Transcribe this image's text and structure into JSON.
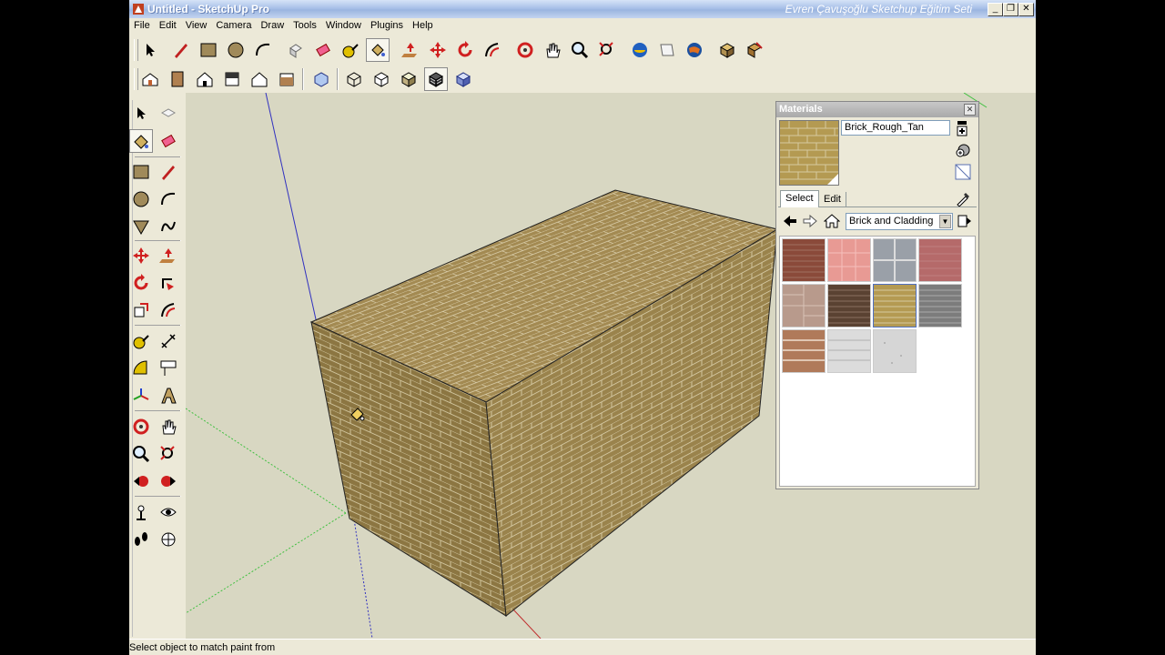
{
  "window": {
    "title": "Untitled - SketchUp Pro",
    "watermark": "Evren Çavuşoğlu Sketchup Eğitim Seti",
    "buttons": [
      "_",
      "❐",
      "✕"
    ]
  },
  "menu": [
    "File",
    "Edit",
    "View",
    "Camera",
    "Draw",
    "Tools",
    "Window",
    "Plugins",
    "Help"
  ],
  "status": {
    "message": "Select object to match paint from"
  },
  "materials": {
    "panel_title": "Materials",
    "close_glyph": "✕",
    "current_name": "Brick_Rough_Tan",
    "tabs": [
      "Select",
      "Edit"
    ],
    "collection": "Brick and Cladding",
    "dropdown_glyph": "▼",
    "swatches": [
      {
        "name": "brick-red-swatch",
        "color": "#8a4a3a"
      },
      {
        "name": "brick-pink-tile-swatch",
        "color": "#e89a94"
      },
      {
        "name": "stone-blue-gray-swatch",
        "color": "#9aa0a8"
      },
      {
        "name": "brick-dusty-red-swatch",
        "color": "#b56a6a"
      },
      {
        "name": "stone-tan-block-swatch",
        "color": "#b89a8c"
      },
      {
        "name": "brick-dark-brown-swatch",
        "color": "#5a4232"
      },
      {
        "name": "brick-rough-tan-swatch",
        "color": "#b49a52"
      },
      {
        "name": "stone-gray-block-swatch",
        "color": "#7c7c7c"
      },
      {
        "name": "cladding-wood-swatch",
        "color": "#b07a5a"
      },
      {
        "name": "cladding-light-gray-swatch",
        "color": "#dcdcdc"
      },
      {
        "name": "stucco-white-swatch",
        "color": "#d6d6d6"
      }
    ]
  },
  "colors": {
    "brick_top": "#a38a52",
    "brick_left": "#8c7642",
    "brick_front": "#9a834c",
    "axis_blue": "#3030c0",
    "axis_red": "#c03030",
    "axis_green": "#40c040"
  }
}
